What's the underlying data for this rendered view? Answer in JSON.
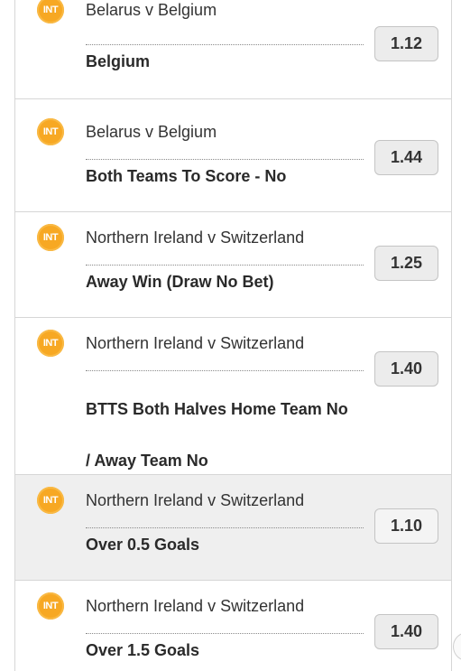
{
  "bets": [
    {
      "competition_badge": "INT",
      "match": "Belarus v Belgium",
      "selection": "Belgium",
      "odds": "1.12",
      "highlighted": false
    },
    {
      "competition_badge": "INT",
      "match": "Belarus v Belgium",
      "selection": "Both Teams To Score - No",
      "odds": "1.44",
      "highlighted": false
    },
    {
      "competition_badge": "INT",
      "match": "Northern Ireland v Switzerland",
      "selection": "Away Win (Draw No Bet)",
      "odds": "1.25",
      "highlighted": false
    },
    {
      "competition_badge": "INT",
      "match": "Northern Ireland v Switzerland",
      "selection": "BTTS Both Halves Home Team No / Away Team No",
      "odds": "1.40",
      "highlighted": false
    },
    {
      "competition_badge": "INT",
      "match": "Northern Ireland v Switzerland",
      "selection": "Over 0.5 Goals",
      "odds": "1.10",
      "highlighted": true
    },
    {
      "competition_badge": "INT",
      "match": "Northern Ireland v Switzerland",
      "selection": "Over 1.5 Goals",
      "odds": "1.40",
      "highlighted": false
    }
  ],
  "colors": {
    "badge": "#f7a823",
    "highlight_row": "#efefef",
    "odds_button": "#ececec"
  }
}
